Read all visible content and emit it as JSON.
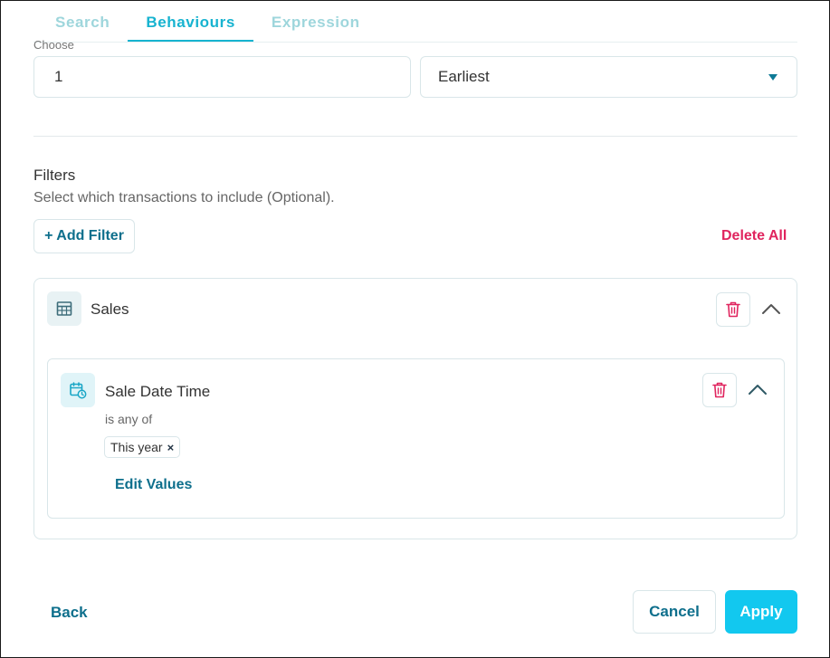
{
  "tabs": [
    {
      "label": "Search",
      "active": false
    },
    {
      "label": "Behaviours",
      "active": true
    },
    {
      "label": "Expression",
      "active": false
    }
  ],
  "choose": {
    "label": "Choose",
    "count_value": "1",
    "order_value": "Earliest"
  },
  "filters": {
    "title": "Filters",
    "subtitle": "Select which transactions to include (Optional).",
    "add_label": "+ Add Filter",
    "delete_all_label": "Delete All",
    "groups": [
      {
        "name": "Sales",
        "icon": "table-icon",
        "conditions": [
          {
            "field": "Sale Date Time",
            "icon": "calendar-clock-icon",
            "operator": "is any of",
            "values": [
              "This year"
            ],
            "edit_label": "Edit Values"
          }
        ]
      }
    ]
  },
  "footer": {
    "back_label": "Back",
    "cancel_label": "Cancel",
    "apply_label": "Apply"
  },
  "colors": {
    "accent": "#12c8ef",
    "tab_active": "#17b3d0",
    "link": "#0e6f8c",
    "danger": "#e0245e",
    "border": "#d9e6e9"
  }
}
